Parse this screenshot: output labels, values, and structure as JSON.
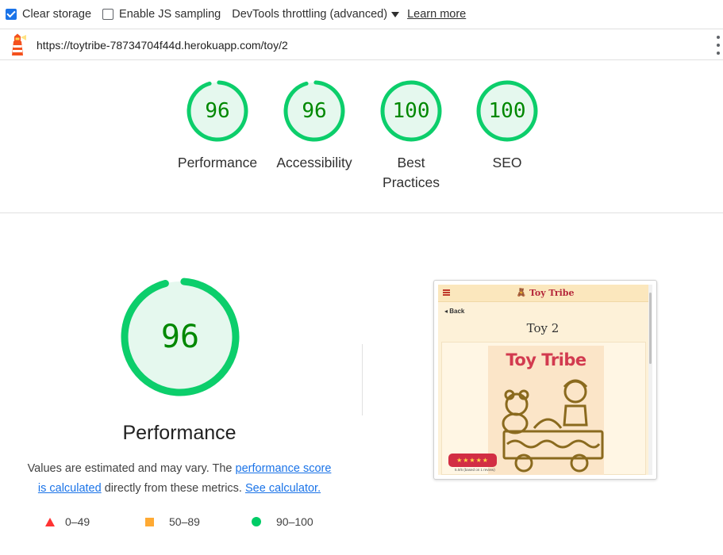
{
  "toolbar": {
    "clear_storage": {
      "label": "Clear storage",
      "checked": true
    },
    "js_sampling": {
      "label": "Enable JS sampling",
      "checked": false
    },
    "throttling": {
      "label": "DevTools throttling (advanced)"
    },
    "learn_more": "Learn more"
  },
  "urlbar": {
    "url": "https://toytribe-78734704f44d.herokuapp.com/toy/2",
    "lighthouse_icon": "lighthouse-icon",
    "menu_icon": "more-vert-icon"
  },
  "scores": [
    {
      "value": "96",
      "fraction": 0.96,
      "label": "Performance"
    },
    {
      "value": "96",
      "fraction": 0.96,
      "label": "Accessibility"
    },
    {
      "value": "100",
      "fraction": 1.0,
      "label": "Best",
      "label2": "Practices"
    },
    {
      "value": "100",
      "fraction": 1.0,
      "label": "SEO"
    }
  ],
  "performance": {
    "score": "96",
    "fraction": 0.96,
    "title": "Performance",
    "desc_prefix": "Values are estimated and may vary. The ",
    "link_score": "performance score",
    "link_calc": "is calculated",
    "desc_middle": " directly from these metrics. ",
    "link_calculator": "See calculator."
  },
  "legend": [
    {
      "label": "0–49",
      "color": "#ff3333",
      "icon": "red-triangle-icon"
    },
    {
      "label": "50–89",
      "color": "#ffaa33",
      "icon": "orange-square-icon"
    },
    {
      "label": "90–100",
      "color": "#00cc66",
      "icon": "green-circle-icon"
    }
  ],
  "preview": {
    "brand": "Toy Tribe",
    "back": "Back",
    "title": "Toy 2",
    "image_text": "Toy Tribe",
    "stars": "★★★★★",
    "reviews": "5.0/5 (based on 1 review)"
  },
  "colors": {
    "pass_green": "#0cce6b",
    "pass_fill": "#e5f8ee",
    "pass_text": "#008800",
    "link_blue": "#1a73e8"
  }
}
